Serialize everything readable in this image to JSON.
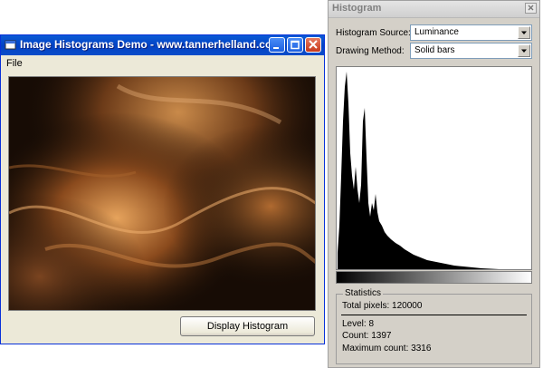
{
  "main_window": {
    "title": "Image Histograms Demo - www.tannerhelland.com",
    "menu": {
      "file": "File"
    },
    "display_button": "Display Histogram"
  },
  "histogram_window": {
    "title": "Histogram",
    "source_label": "Histogram Source:",
    "source_value": "Luminance",
    "method_label": "Drawing Method:",
    "method_value": "Solid bars",
    "stats": {
      "legend": "Statistics",
      "total_pixels": "Total pixels: 120000",
      "level": "Level: 8",
      "count": "Count: 1397",
      "max_count": "Maximum count: 3316"
    }
  },
  "colors": {
    "titlebar_blue": "#0342c4",
    "window_face": "#ece9d8",
    "tool_face": "#d4d0c8"
  }
}
